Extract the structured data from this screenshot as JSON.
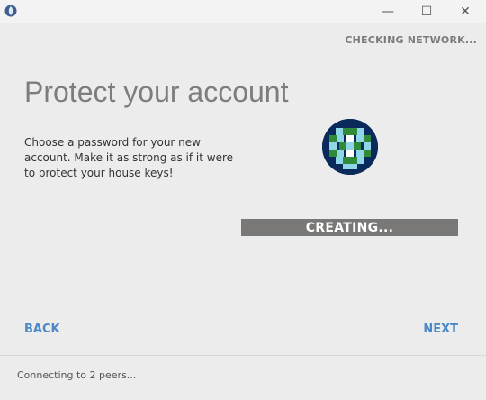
{
  "window": {
    "minimize_glyph": "—",
    "maximize_glyph": "☐",
    "close_glyph": "✕",
    "icon": "app-globe-icon"
  },
  "header": {
    "status": "CHECKING NETWORK..."
  },
  "main": {
    "title": "Protect your account",
    "description": "Choose a password for your new account. Make it as strong as if it were to protect your house keys!",
    "avatar_icon": "identicon-avatar",
    "progress_label": "CREATING...",
    "progress_fraction": 1.0
  },
  "nav": {
    "back_label": "BACK",
    "next_label": "NEXT"
  },
  "footer": {
    "status": "Connecting to 2 peers..."
  },
  "colors": {
    "accent": "#4a88c7",
    "progress_bar": "#7a7876",
    "avatar_dark": "#0b2a5c",
    "avatar_light": "#8fd6e8",
    "avatar_green": "#2f8a3a"
  }
}
